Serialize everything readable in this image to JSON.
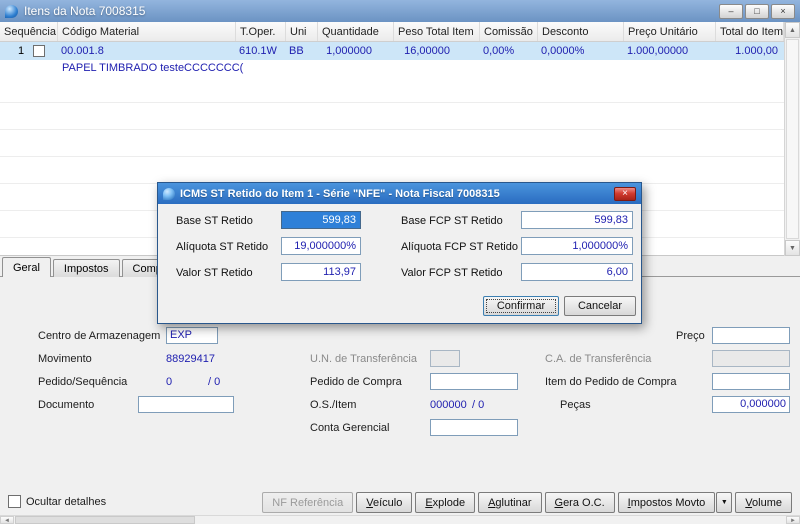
{
  "window": {
    "title": "Itens da Nota 7008315"
  },
  "icons": {
    "minimize": "–",
    "maximize": "□",
    "close": "×",
    "up_arrow": "▲",
    "down_arrow": "▼",
    "left_arrow": "◄",
    "right_arrow": "►",
    "dropdown": "▼"
  },
  "colors": {
    "row_highlight": "#cde6f8",
    "selection_blue": "#2e80d8",
    "value_navy": "#2121b0",
    "dialog_title_blue": "#2a6cc0",
    "close_button_red": "#c9302c"
  },
  "grid": {
    "columns": [
      "Sequência",
      "Código Material",
      "T.Oper.",
      "Uni",
      "Quantidade",
      "Peso Total Item",
      "Comissão",
      "Desconto",
      "Preço Unitário",
      "Total do Item"
    ],
    "rows": [
      {
        "sequencia": "1",
        "codigo_material": "00.001.8",
        "t_oper": "610.1W",
        "uni": "BB",
        "quantidade": "1,000000",
        "peso_total_item": "16,00000",
        "comissao": "0,00%",
        "desconto": "0,0000%",
        "preco_unitario": "1.000,00000",
        "total_do_item": "1.000,00",
        "descricao": "PAPEL TIMBRADO testeCCCCCCC("
      }
    ]
  },
  "tabs": [
    {
      "label": "Geral"
    },
    {
      "label": "Impostos"
    },
    {
      "label": "Complement"
    }
  ],
  "dialog": {
    "title": "ICMS ST Retido do Item 1 - Série \"NFE\" - Nota Fiscal 7008315",
    "fields": {
      "base_st": {
        "label": "Base ST Retido",
        "value": "599,83"
      },
      "base_fcp": {
        "label": "Base FCP ST Retido",
        "value": "599,83"
      },
      "aliquota_st": {
        "label": "Alíquota ST Retido",
        "value": "19,000000%"
      },
      "aliquota_fcp": {
        "label": "Alíquota FCP ST Retido",
        "value": "1,000000%"
      },
      "valor_st": {
        "label": "Valor ST Retido",
        "value": "113,97"
      },
      "valor_fcp": {
        "label": "Valor FCP ST Retido",
        "value": "6,00"
      }
    },
    "buttons": {
      "confirmar": "Confirmar",
      "cancelar": "Cancelar"
    }
  },
  "form": {
    "centro_armazenagem": {
      "label": "Centro de Armazenagem",
      "value": "EXP"
    },
    "movimento": {
      "label": "Movimento",
      "value": "88929417"
    },
    "pedido_sequencia": {
      "label": "Pedido/Sequência",
      "value": "0",
      "value2": "/ 0"
    },
    "documento": {
      "label": "Documento",
      "value": ""
    },
    "un_transferencia": {
      "label": "U.N. de Transferência",
      "value": ""
    },
    "pedido_compra": {
      "label": "Pedido de Compra",
      "value": ""
    },
    "os_item": {
      "label": "O.S./Item",
      "value": "000000",
      "value2": "/ 0"
    },
    "conta_gerencial": {
      "label": "Conta Gerencial",
      "value": ""
    },
    "preco": {
      "label": "Preço",
      "value": ""
    },
    "ca_transferencia": {
      "label": "C.A. de Transferência",
      "value": ""
    },
    "item_pedido_compra": {
      "label": "Item do Pedido de Compra",
      "value": ""
    },
    "pecas": {
      "label": "Peças",
      "value": "0,000000"
    }
  },
  "footer": {
    "ocultar_detalhes": "Ocultar detalhes",
    "buttons": {
      "nf_referencia": "NF Referência",
      "veiculo": "Veículo",
      "explode": "Explode",
      "aglutinar": "Aglutinar",
      "gera_oc": "Gera O.C.",
      "impostos_movto": "Impostos Movto",
      "volume": "Volume"
    }
  }
}
